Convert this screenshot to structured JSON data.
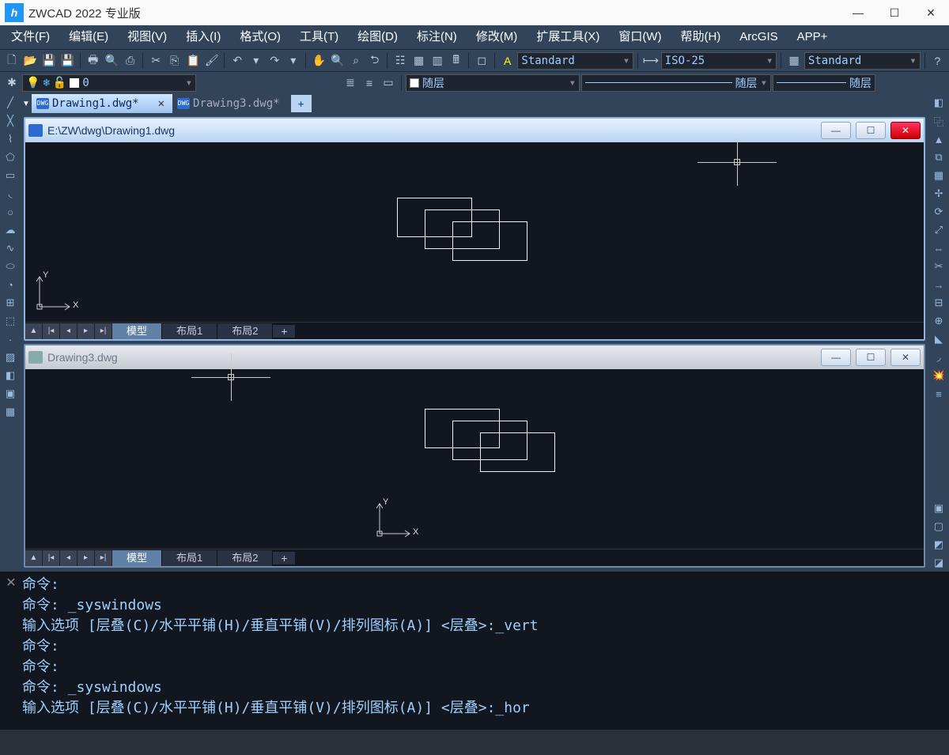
{
  "app": {
    "title": "ZWCAD 2022 专业版"
  },
  "menu": [
    "文件(F)",
    "编辑(E)",
    "视图(V)",
    "插入(I)",
    "格式(O)",
    "工具(T)",
    "绘图(D)",
    "标注(N)",
    "修改(M)",
    "扩展工具(X)",
    "窗口(W)",
    "帮助(H)",
    "ArcGIS",
    "APP+"
  ],
  "toolbar2": {
    "layer_value": "0",
    "text_style": "Standard",
    "dim_style": "ISO-25",
    "table_style": "Standard",
    "color_label": "随层",
    "ltype_label": "随层",
    "lweight_label": "随层"
  },
  "tabs": {
    "active": "Drawing1.dwg*",
    "inactive": "Drawing3.dwg*",
    "add": "+"
  },
  "child1": {
    "title": "E:\\ZW\\dwg\\Drawing1.dwg",
    "layouts": {
      "model": "模型",
      "l1": "布局1",
      "l2": "布局2",
      "add": "+"
    }
  },
  "child2": {
    "title": "Drawing3.dwg",
    "layouts": {
      "model": "模型",
      "l1": "布局1",
      "l2": "布局2",
      "add": "+"
    }
  },
  "ucs": {
    "x": "X",
    "y": "Y"
  },
  "cmd": {
    "lines": [
      "命令:",
      "命令: _syswindows",
      "输入选项 [层叠(C)/水平平铺(H)/垂直平铺(V)/排列图标(A)] <层叠>:_vert",
      "命令:",
      "命令:",
      "命令: _syswindows",
      "输入选项 [层叠(C)/水平平铺(H)/垂直平铺(V)/排列图标(A)] <层叠>:_hor"
    ]
  }
}
